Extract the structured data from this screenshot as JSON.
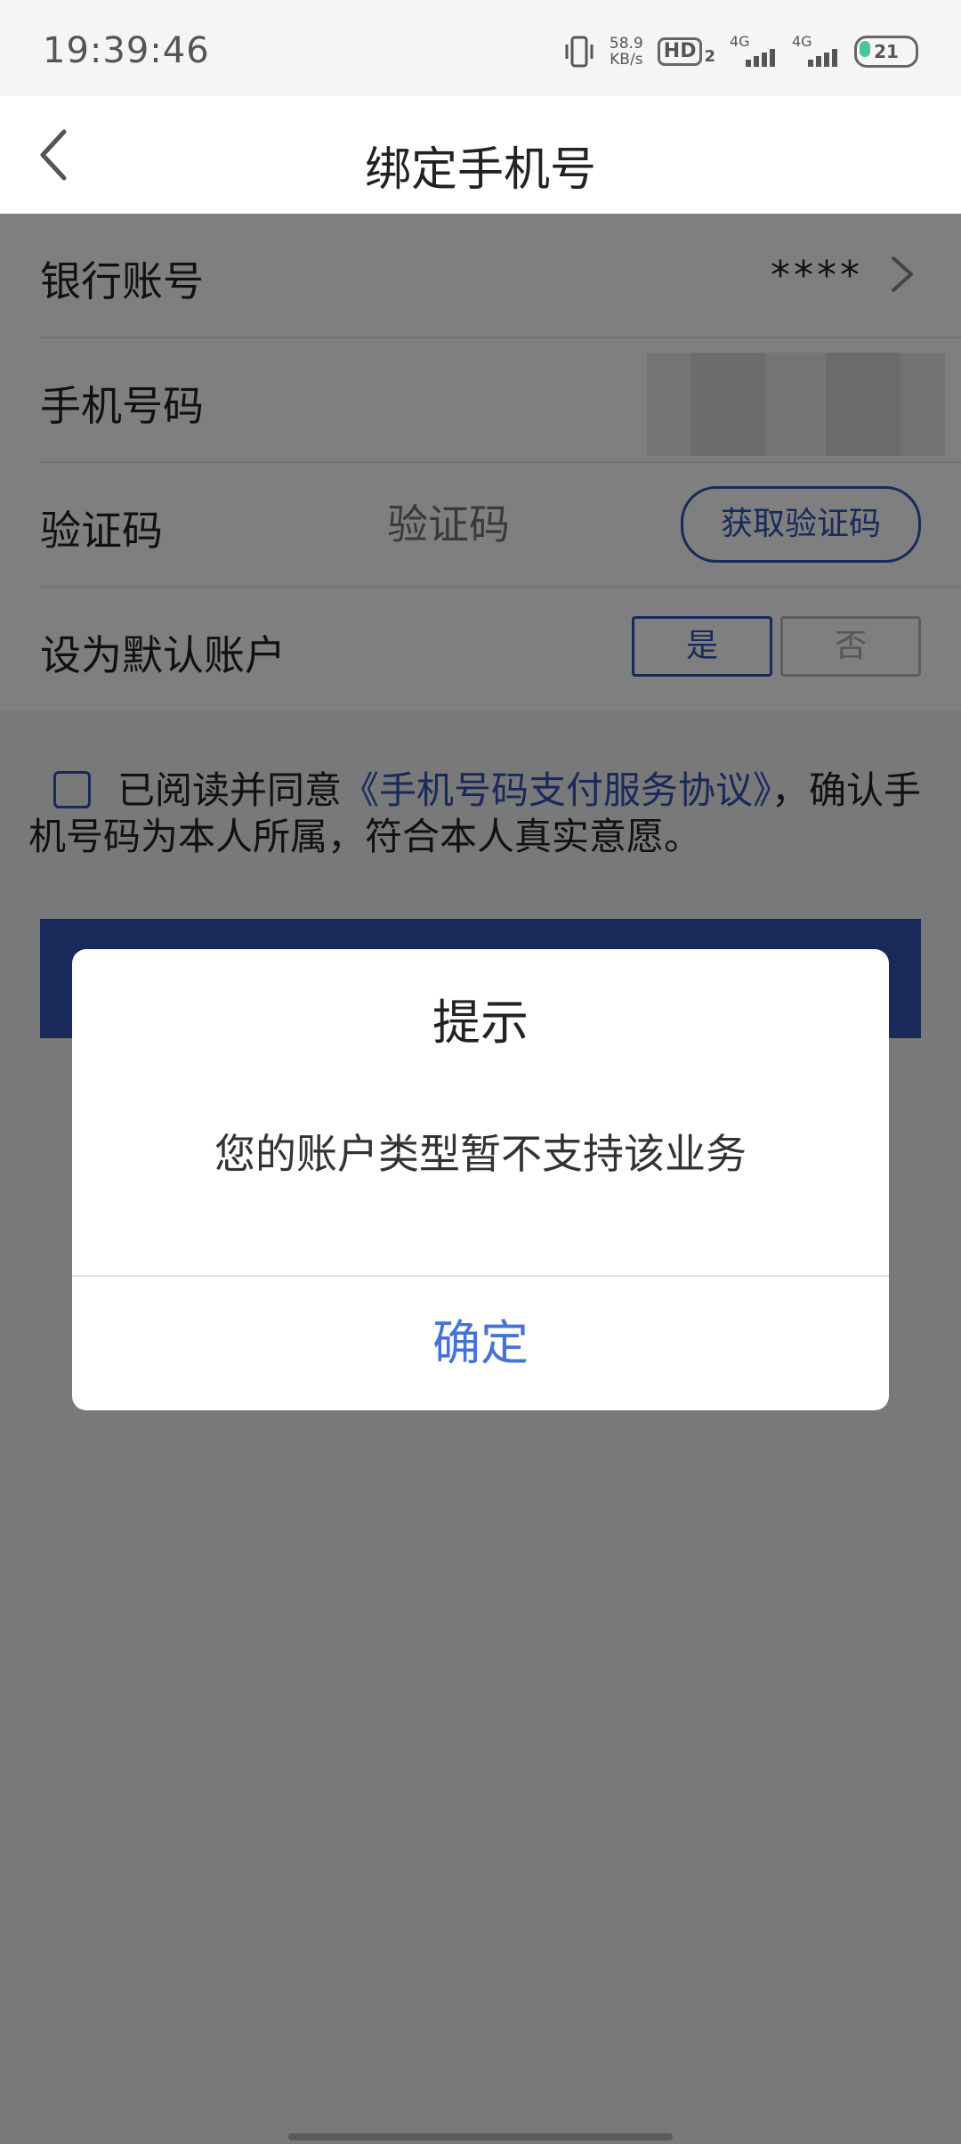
{
  "status_bar": {
    "time": "19:39:46",
    "net_speed_value": "58.9",
    "net_speed_unit": "KB/s",
    "hd_label": "HD",
    "hd_sub": "2",
    "sim1_label": "4G",
    "sim2_label": "4G",
    "battery_level": "21"
  },
  "header": {
    "title": "绑定手机号"
  },
  "form": {
    "bank_account_label": "银行账号",
    "bank_account_value": "****",
    "phone_label": "手机号码",
    "code_label": "验证码",
    "code_placeholder": "验证码",
    "get_code_label": "获取验证码",
    "default_label": "设为默认账户",
    "default_yes": "是",
    "default_no": "否"
  },
  "agreement": {
    "prefix": "已阅读并同意",
    "link": "《手机号码支付服务协议》",
    "suffix": "，确认手机号码为本人所属，符合本人真实意愿。"
  },
  "dialog": {
    "title": "提示",
    "message": "您的账户类型暂不支持该业务",
    "ok_label": "确定"
  },
  "colors": {
    "accent": "#3352b5",
    "dialog_button": "#4573d8",
    "overlay": "rgba(0,0,0,0.5)"
  }
}
